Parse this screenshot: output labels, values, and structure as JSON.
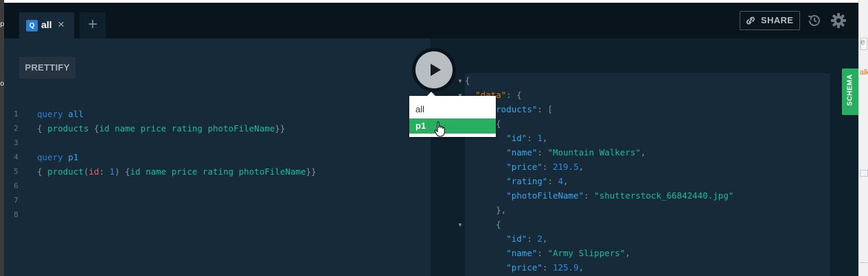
{
  "tabs": [
    {
      "badge": "Q",
      "label": "all"
    }
  ],
  "toolbar": {
    "share_label": "SHARE",
    "prettify_label": "PRETTIFY",
    "schema_label": "SCHEMA"
  },
  "editor": {
    "lines": [
      {
        "n": "1",
        "tokens": [
          [
            "kw",
            "query"
          ],
          [
            "br",
            " "
          ],
          [
            "nm",
            "all"
          ]
        ]
      },
      {
        "n": "2",
        "tokens": [
          [
            "br",
            "{ "
          ],
          [
            "fld",
            "products"
          ],
          [
            "br",
            " {"
          ],
          [
            "fld",
            "id"
          ],
          [
            "br",
            " "
          ],
          [
            "fld",
            "name"
          ],
          [
            "br",
            " "
          ],
          [
            "fld",
            "price"
          ],
          [
            "br",
            " "
          ],
          [
            "fld",
            "rating"
          ],
          [
            "br",
            " "
          ],
          [
            "fld",
            "photoFileName"
          ],
          [
            "br",
            "}}"
          ]
        ]
      },
      {
        "n": "3",
        "tokens": []
      },
      {
        "n": "4",
        "tokens": [
          [
            "kw",
            "query"
          ],
          [
            "br",
            " "
          ],
          [
            "nm",
            "p1"
          ]
        ]
      },
      {
        "n": "5",
        "tokens": [
          [
            "br",
            "{ "
          ],
          [
            "fld",
            "product"
          ],
          [
            "br",
            "("
          ],
          [
            "arg",
            "id"
          ],
          [
            "br",
            ": "
          ],
          [
            "num",
            "1"
          ],
          [
            "br",
            ") {"
          ],
          [
            "fld",
            "id"
          ],
          [
            "br",
            " "
          ],
          [
            "fld",
            "name"
          ],
          [
            "br",
            " "
          ],
          [
            "fld",
            "price"
          ],
          [
            "br",
            " "
          ],
          [
            "fld",
            "rating"
          ],
          [
            "br",
            " "
          ],
          [
            "fld",
            "photoFileName"
          ],
          [
            "br",
            "}}"
          ]
        ]
      },
      {
        "n": "6",
        "tokens": []
      },
      {
        "n": "7",
        "tokens": []
      },
      {
        "n": "8",
        "tokens": []
      }
    ]
  },
  "operations_menu": {
    "options": [
      "all",
      "p1"
    ],
    "selected": "p1"
  },
  "result": {
    "lines": [
      [
        [
          "p",
          "{"
        ]
      ],
      [
        [
          "p",
          "  "
        ],
        [
          "jdata",
          "\"data\""
        ],
        [
          "p",
          ": {"
        ]
      ],
      [
        [
          "p",
          "    "
        ],
        [
          "jk",
          "\"products\""
        ],
        [
          "p",
          ": ["
        ]
      ],
      [
        [
          "p",
          "      {"
        ]
      ],
      [
        [
          "p",
          "        "
        ],
        [
          "jk",
          "\"id\""
        ],
        [
          "p",
          ": "
        ],
        [
          "jn",
          "1"
        ],
        [
          "p",
          ","
        ]
      ],
      [
        [
          "p",
          "        "
        ],
        [
          "jk",
          "\"name\""
        ],
        [
          "p",
          ": "
        ],
        [
          "js",
          "\"Mountain Walkers\""
        ],
        [
          "p",
          ","
        ]
      ],
      [
        [
          "p",
          "        "
        ],
        [
          "jk",
          "\"price\""
        ],
        [
          "p",
          ": "
        ],
        [
          "jn",
          "219.5"
        ],
        [
          "p",
          ","
        ]
      ],
      [
        [
          "p",
          "        "
        ],
        [
          "jk",
          "\"rating\""
        ],
        [
          "p",
          ": "
        ],
        [
          "jn",
          "4"
        ],
        [
          "p",
          ","
        ]
      ],
      [
        [
          "p",
          "        "
        ],
        [
          "jk",
          "\"photoFileName\""
        ],
        [
          "p",
          ": "
        ],
        [
          "js",
          "\"shutterstock_66842440.jpg\""
        ]
      ],
      [
        [
          "p",
          "      },"
        ]
      ],
      [
        [
          "p",
          "      {"
        ]
      ],
      [
        [
          "p",
          "        "
        ],
        [
          "jk",
          "\"id\""
        ],
        [
          "p",
          ": "
        ],
        [
          "jn",
          "2"
        ],
        [
          "p",
          ","
        ]
      ],
      [
        [
          "p",
          "        "
        ],
        [
          "jk",
          "\"name\""
        ],
        [
          "p",
          ": "
        ],
        [
          "js",
          "\"Army Slippers\""
        ],
        [
          "p",
          ","
        ]
      ],
      [
        [
          "p",
          "        "
        ],
        [
          "jk",
          "\"price\""
        ],
        [
          "p",
          ": "
        ],
        [
          "jn",
          "125.9"
        ],
        [
          "p",
          ","
        ]
      ]
    ]
  },
  "edge_text": {
    "left": [
      "p",
      "o"
    ],
    "right_box": "e",
    "right_orange": "alk"
  },
  "colors": {
    "accent_green": "#27ae60",
    "query_badge": "#2a7ed2",
    "background": "#0f202d"
  }
}
